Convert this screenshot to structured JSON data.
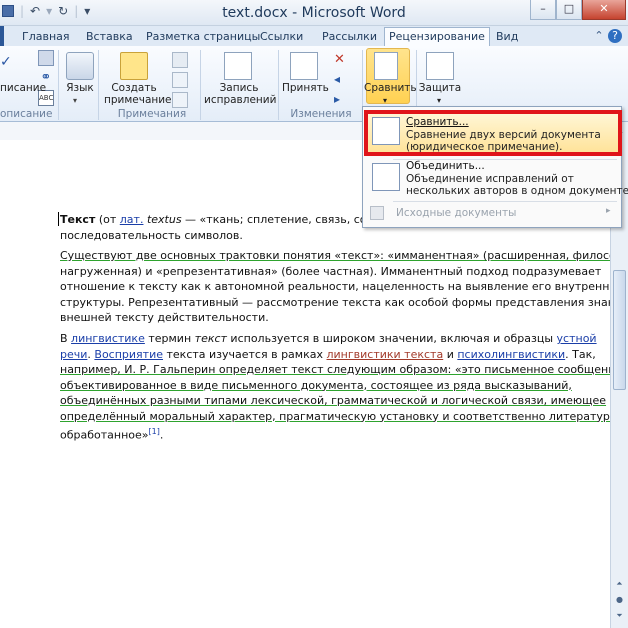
{
  "window": {
    "title": "text.docx - Microsoft Word",
    "qat_icons": [
      "save-icon",
      "undo-icon",
      "redo-icon",
      "qat-customize-icon"
    ],
    "controls": [
      "minimize",
      "maximize",
      "close"
    ]
  },
  "tabs": [
    "Главная",
    "Вставка",
    "Разметка страницы",
    "Ссылки",
    "Рассылки",
    "Рецензирование",
    "Вид"
  ],
  "active_tab": "Рецензирование",
  "ribbon": {
    "groups": {
      "proofing_label": "описание",
      "proofing_btn": "писание",
      "language_btn": "Язык",
      "comments_label": "Примечания",
      "new_comment_1": "Создать",
      "new_comment_2": "примечание",
      "track_1": "Запись",
      "track_2": "исправлений",
      "changes_label": "Изменения",
      "accept_btn": "Принять",
      "compare_btn": "Сравнить",
      "protect_btn": "Защита"
    }
  },
  "dropdown": {
    "compare_title": "Сравнить...",
    "compare_desc_1": "Сравнение двух версий документа",
    "compare_desc_2": "(юридическое примечание).",
    "combine_title": "Объединить...",
    "combine_desc_1": "Объединение исправлений от",
    "combine_desc_2": "нескольких авторов в одном документе.",
    "source_docs": "Исходные документы"
  },
  "document": {
    "p1": {
      "l1_bold": "Текст",
      "l1_a": " (от ",
      "l1_lat": "лат.",
      "l1_b": " ",
      "l1_textus": "textus",
      "l1_c": " — «ткань; сплетение, связь, сочетание»",
      "l2": "последовательность символов."
    },
    "p2": [
      "Существуют две основных трактовки понятия «текст»: «имманентная» (расширенная, философски",
      "нагруженная) и «репрезентативная» (более частная). Имманентный подход подразумевает",
      "отношение к тексту как к автономной реальности, нацеленность на выявление его внутренней",
      "структуры. Репрезентативный — рассмотрение текста как особой формы представления знаний о",
      "внешней тексту действительности."
    ],
    "p3": {
      "l1_a": "В ",
      "l1_ling": "лингвистике",
      "l1_b": " термин ",
      "l1_text": "текст",
      "l1_c": " используется в широком значении, включая и образцы ",
      "l1_oral": "устной",
      "l2_speech": "речи",
      "l2_a": ". ",
      "l2_perception": "Восприятие",
      "l2_b": " текста изучается в рамках ",
      "l2_ling_text": "лингвистики текста",
      "l2_c": " и ",
      "l2_psycho": "психолингвистики",
      "l2_d": ". Так,",
      "l3": "например, И. Р. Гальперин определяет текст следующим образом: «это письменное сообщение,",
      "l4": "объективированное в виде письменного документа, состоящее из ряда высказываний,",
      "l5": "объединённых разными типами лексической, грамматической и логической связи, имеющее",
      "l6": "определённый моральный характер, прагматическую установку и соответственно литературно",
      "l7": "обработанное»",
      "ref": "[1]",
      "end": "."
    }
  }
}
